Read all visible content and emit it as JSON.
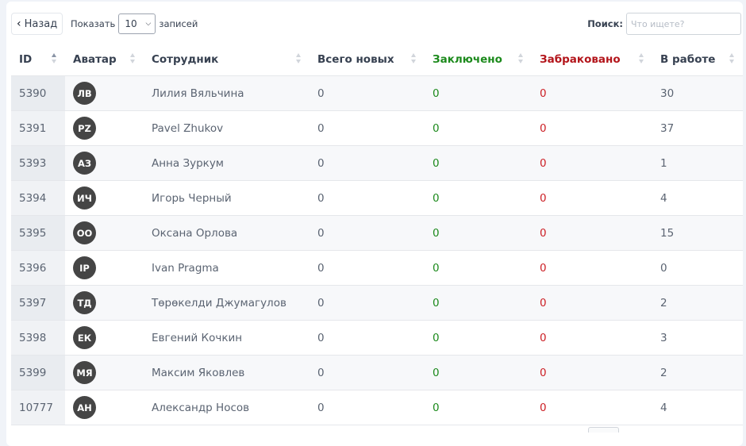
{
  "toolbar": {
    "back_label": "Назад",
    "show_label": "Показать",
    "page_size": "10",
    "entries_label": "записей",
    "search_label": "Поиск:",
    "search_placeholder": "Что ищете?"
  },
  "columns": [
    {
      "label": "ID",
      "key": "id"
    },
    {
      "label": "Аватар",
      "key": "avatar"
    },
    {
      "label": "Сотрудник",
      "key": "employee"
    },
    {
      "label": "Всего новых",
      "key": "total_new"
    },
    {
      "label": "Заключено",
      "key": "closed"
    },
    {
      "label": "Забраковано",
      "key": "rejected"
    },
    {
      "label": "В работе",
      "key": "in_progress"
    }
  ],
  "colors": {
    "closed": "#1c8a1c",
    "rejected": "#cc1f25",
    "avatar_bg": "#454545"
  },
  "rows": [
    {
      "id": "5390",
      "initials": "ЛВ",
      "name": "Лилия Вяльчина",
      "total_new": "0",
      "closed": "0",
      "rejected": "0",
      "in_progress": "30"
    },
    {
      "id": "5391",
      "initials": "PZ",
      "name": "Pavel Zhukov",
      "total_new": "0",
      "closed": "0",
      "rejected": "0",
      "in_progress": "37"
    },
    {
      "id": "5393",
      "initials": "АЗ",
      "name": "Анна Зуркум",
      "total_new": "0",
      "closed": "0",
      "rejected": "0",
      "in_progress": "1"
    },
    {
      "id": "5394",
      "initials": "ИЧ",
      "name": "Игорь Черный",
      "total_new": "0",
      "closed": "0",
      "rejected": "0",
      "in_progress": "4"
    },
    {
      "id": "5395",
      "initials": "ОО",
      "name": "Оксана Орлова",
      "total_new": "0",
      "closed": "0",
      "rejected": "0",
      "in_progress": "15"
    },
    {
      "id": "5396",
      "initials": "IP",
      "name": "Ivan Pragma",
      "total_new": "0",
      "closed": "0",
      "rejected": "0",
      "in_progress": "0"
    },
    {
      "id": "5397",
      "initials": "ТД",
      "name": "Төрөкелди Джумагулов",
      "total_new": "0",
      "closed": "0",
      "rejected": "0",
      "in_progress": "2"
    },
    {
      "id": "5398",
      "initials": "ЕК",
      "name": "Евгений Кочкин",
      "total_new": "0",
      "closed": "0",
      "rejected": "0",
      "in_progress": "3"
    },
    {
      "id": "5399",
      "initials": "МЯ",
      "name": "Максим Яковлев",
      "total_new": "0",
      "closed": "0",
      "rejected": "0",
      "in_progress": "2"
    },
    {
      "id": "10777",
      "initials": "АН",
      "name": "Александр Носов",
      "total_new": "0",
      "closed": "0",
      "rejected": "0",
      "in_progress": "4"
    }
  ]
}
